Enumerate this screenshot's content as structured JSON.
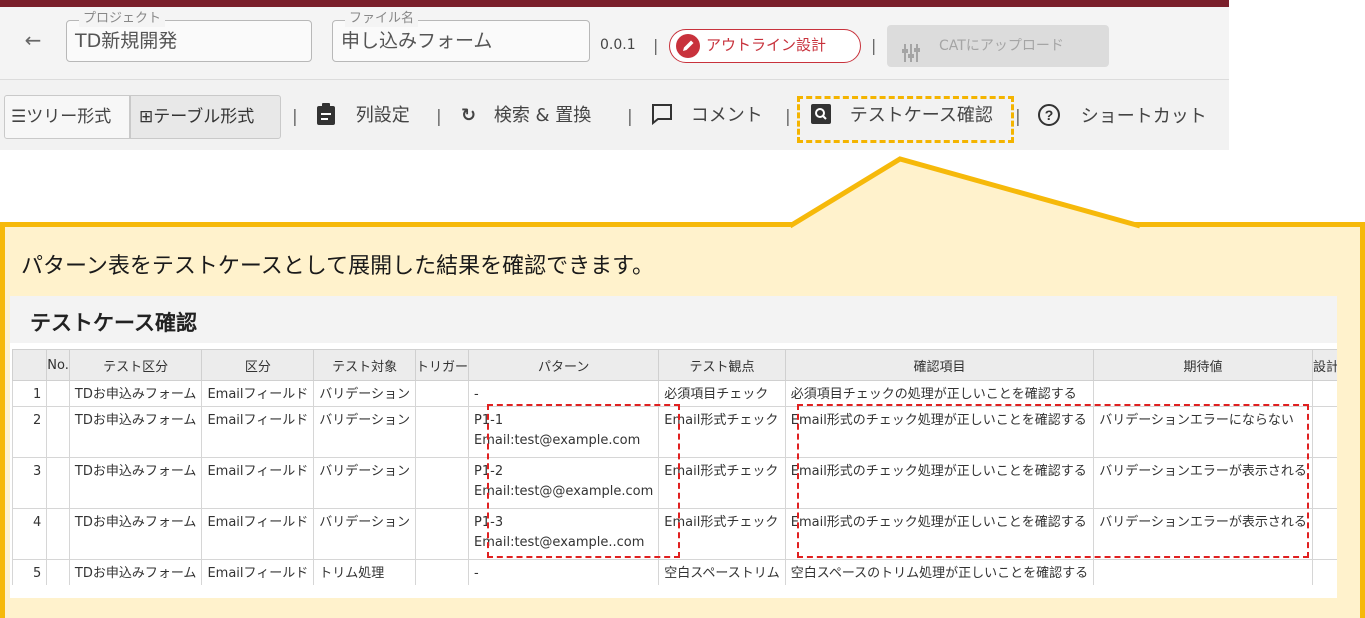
{
  "header": {
    "project_legend": "プロジェクト",
    "project_value": "TD新規開発",
    "file_legend": "ファイル名",
    "file_value": "申し込みフォーム",
    "version": "0.0.1",
    "separator": "|",
    "outline_button": "アウトライン設計",
    "cat_button": "CATにアップロード"
  },
  "toolbar": {
    "tree_view": "ツリー形式",
    "table_view": "テーブル形式",
    "column_settings": "列設定",
    "search_replace": "検索 & 置換",
    "comment": "コメント",
    "testcase_check": "テストケース確認",
    "shortcut": "ショートカット"
  },
  "callout": {
    "text": "パターン表をテストケースとして展開した結果を確認できます。"
  },
  "panel": {
    "title": "テストケース確認",
    "columns": [
      "",
      "No.",
      "テスト区分",
      "区分",
      "テスト対象",
      "トリガー",
      "パターン",
      "テスト観点",
      "確認項目",
      "期待値",
      "設計"
    ],
    "rows": [
      {
        "index": "1",
        "no": "",
        "category": "TDお申込みフォーム",
        "section": "Emailフィールド",
        "target": "バリデーション",
        "trigger": "",
        "pattern": "-",
        "pattern_sub": "",
        "viewpoint": "必須項目チェック",
        "check": "必須項目チェックの処理が正しいことを確認する",
        "expected": "",
        "design": ""
      },
      {
        "index": "2",
        "no": "",
        "category": "TDお申込みフォーム",
        "section": "Emailフィールド",
        "target": "バリデーション",
        "trigger": "",
        "pattern": "P1-1",
        "pattern_sub": "Email:test@example.com",
        "viewpoint": "Email形式チェック",
        "check": "Email形式のチェック処理が正しいことを確認する",
        "expected": "バリデーションエラーにならない",
        "design": ""
      },
      {
        "index": "3",
        "no": "",
        "category": "TDお申込みフォーム",
        "section": "Emailフィールド",
        "target": "バリデーション",
        "trigger": "",
        "pattern": "P1-2",
        "pattern_sub": "Email:test@@example.com",
        "viewpoint": "Email形式チェック",
        "check": "Email形式のチェック処理が正しいことを確認する",
        "expected": "バリデーションエラーが表示される",
        "design": ""
      },
      {
        "index": "4",
        "no": "",
        "category": "TDお申込みフォーム",
        "section": "Emailフィールド",
        "target": "バリデーション",
        "trigger": "",
        "pattern": "P1-3",
        "pattern_sub": "Email:test@example..com",
        "viewpoint": "Email形式チェック",
        "check": "Email形式のチェック処理が正しいことを確認する",
        "expected": "バリデーションエラーが表示される",
        "design": ""
      },
      {
        "index": "5",
        "no": "",
        "category": "TDお申込みフォーム",
        "section": "Emailフィールド",
        "target": "トリム処理",
        "trigger": "",
        "pattern": "-",
        "pattern_sub": "",
        "viewpoint": "空白スペーストリム",
        "check": "空白スペースのトリム処理が正しいことを確認する",
        "expected": "",
        "design": ""
      }
    ]
  },
  "colors": {
    "brand_dark": "#7a1f2b",
    "accent_red": "#c8323c",
    "callout_border": "#f6b90a",
    "callout_fill": "#fff2cc",
    "annotation_red": "#e02020"
  }
}
